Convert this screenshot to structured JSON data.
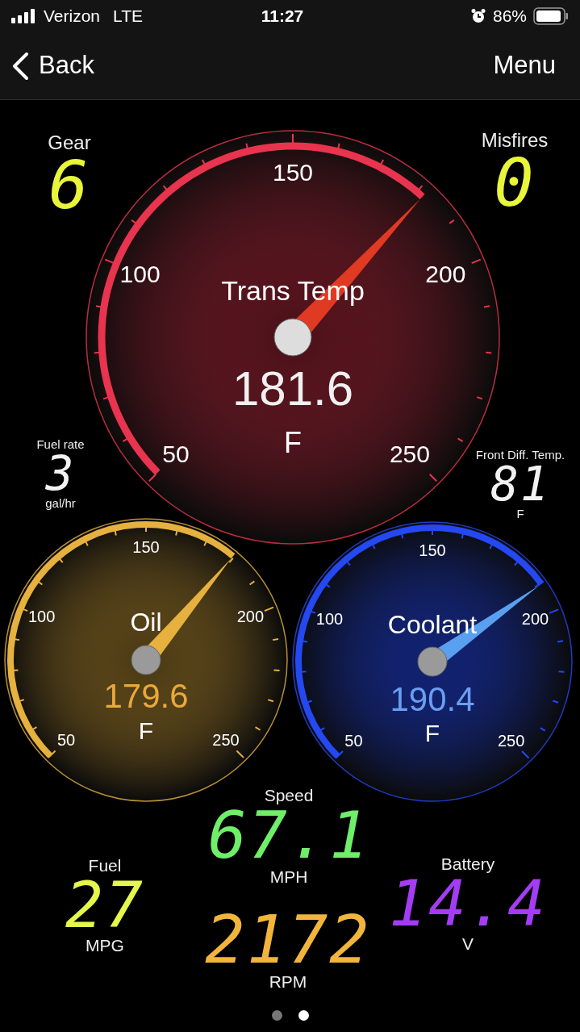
{
  "status_bar": {
    "carrier": "Verizon",
    "network": "LTE",
    "time": "11:27",
    "battery": "86%"
  },
  "nav": {
    "back": "Back",
    "menu": "Menu"
  },
  "gauges": [
    {
      "title": "Trans Temp",
      "value": "181.6",
      "unit": "F",
      "ticks": [
        "50",
        "100",
        "150",
        "200",
        "250"
      ],
      "color": "#e8344e"
    },
    {
      "title": "Oil",
      "value": "179.6",
      "unit": "F",
      "ticks": [
        "50",
        "100",
        "150",
        "200",
        "250"
      ],
      "color": "#e6b13e"
    },
    {
      "title": "Coolant",
      "value": "190.4",
      "unit": "F",
      "ticks": [
        "50",
        "100",
        "150",
        "200",
        "250"
      ],
      "color": "#2448f2"
    }
  ],
  "readouts": [
    {
      "label": "Gear",
      "value": "6",
      "color": "#e8f53a"
    },
    {
      "label": "Misfires",
      "value": "0",
      "color": "#e8f53a"
    },
    {
      "label": "Fuel rate",
      "value": "3",
      "unit": "gal/hr",
      "color": "#f2f2f2"
    },
    {
      "label": "Front Diff. Temp.",
      "value": "81",
      "unit": "F",
      "color": "#f2f2f2"
    },
    {
      "label": "Speed",
      "value": "67.1",
      "unit": "MPH",
      "color": "#6fee6a"
    },
    {
      "label": "Fuel",
      "value": "27",
      "unit": "MPG",
      "color": "#e4f74a"
    },
    {
      "value": "2172",
      "unit": "RPM",
      "color": "#f2b53c"
    },
    {
      "label": "Battery",
      "value": "14.4",
      "unit": "V",
      "color": "#a53cf5"
    }
  ],
  "pages": [
    {
      "selected": false
    },
    {
      "selected": true
    }
  ]
}
